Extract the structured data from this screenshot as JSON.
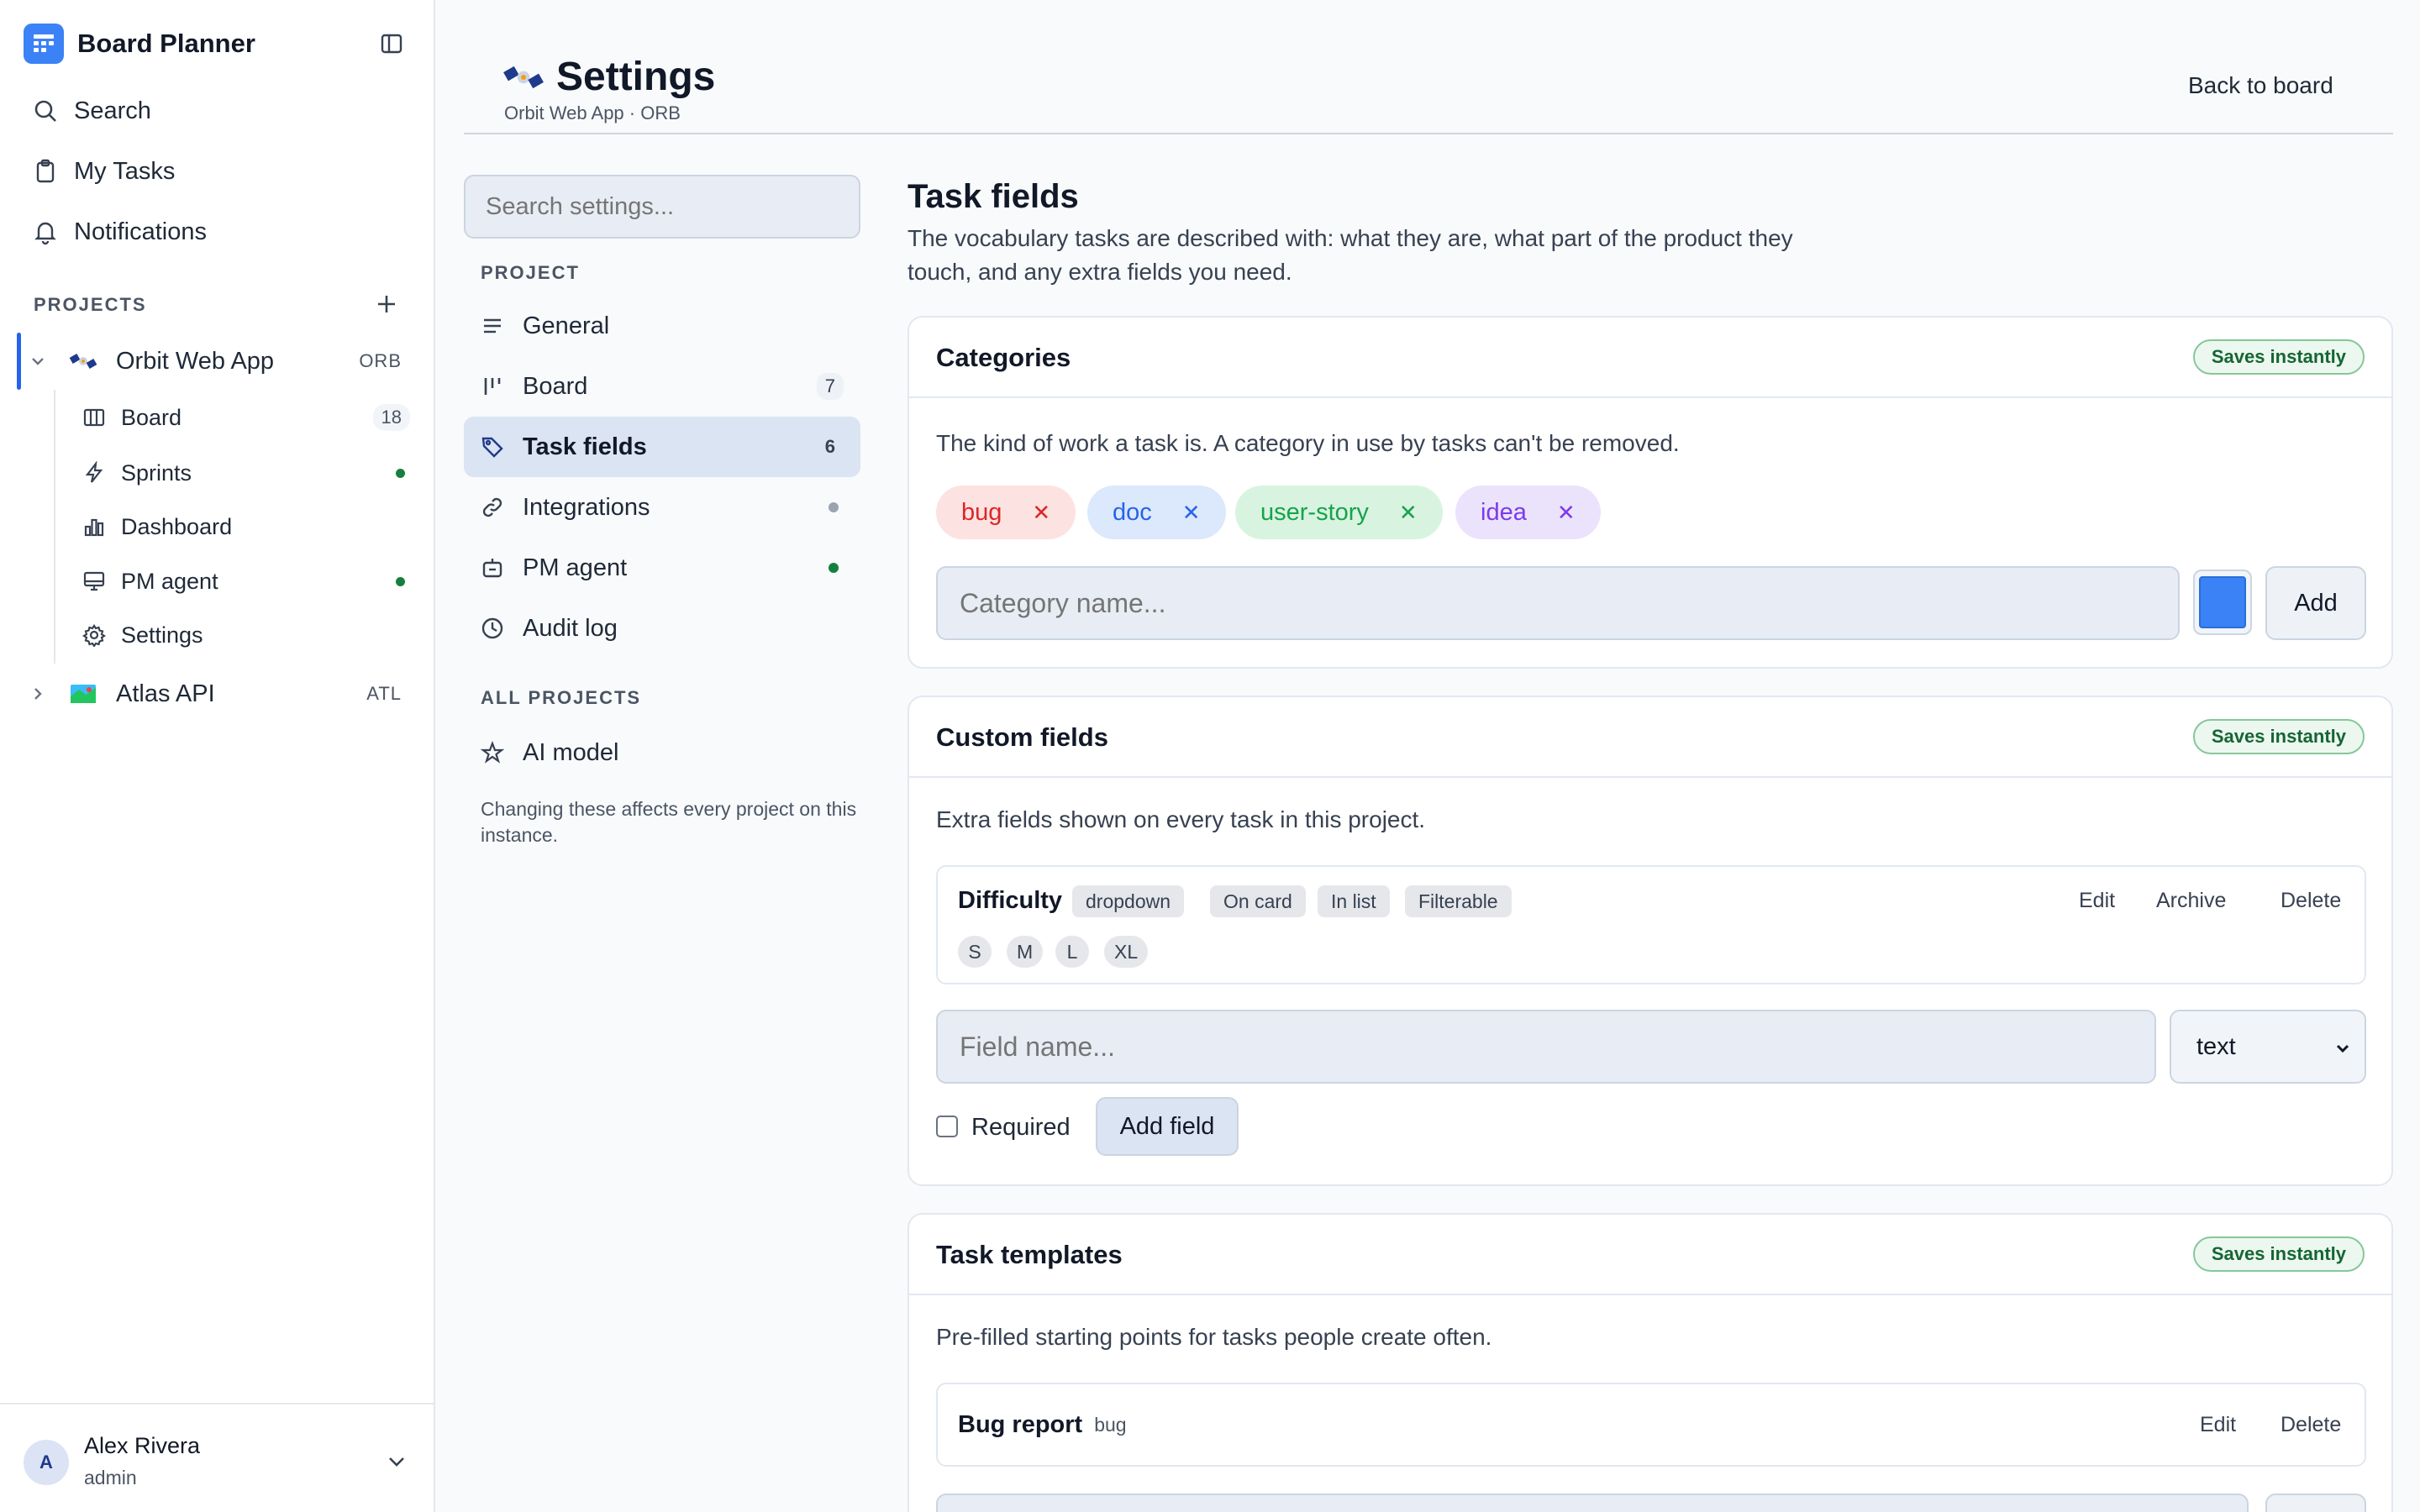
{
  "app": {
    "name": "Board Planner"
  },
  "nav": {
    "search": "Search",
    "my_tasks": "My Tasks",
    "notifications": "Notifications"
  },
  "projects": {
    "label": "PROJECTS",
    "items": [
      {
        "name": "Orbit Web App",
        "key": "ORB",
        "expanded": true,
        "children": [
          {
            "label": "Board",
            "count": "18",
            "icon": "columns-icon"
          },
          {
            "label": "Sprints",
            "status": "active",
            "icon": "lightning-icon"
          },
          {
            "label": "Dashboard",
            "icon": "bar-chart-icon"
          },
          {
            "label": "PM agent",
            "status": "active",
            "icon": "monitor-icon"
          },
          {
            "label": "Settings",
            "icon": "gear-icon"
          }
        ]
      },
      {
        "name": "Atlas API",
        "key": "ATL",
        "expanded": false
      }
    ]
  },
  "user": {
    "initial": "A",
    "name": "Alex Rivera",
    "role": "admin"
  },
  "header": {
    "title": "Settings",
    "subtitle": "Orbit Web App · ORB",
    "back_link": "Back to board"
  },
  "settings_nav": {
    "search_placeholder": "Search settings...",
    "project_label": "PROJECT",
    "items": [
      {
        "label": "General",
        "icon": "lines-icon"
      },
      {
        "label": "Board",
        "badge": "7",
        "icon": "board-icon"
      },
      {
        "label": "Task fields",
        "badge": "6",
        "icon": "tag-icon",
        "active": true
      },
      {
        "label": "Integrations",
        "status": "gray",
        "icon": "link-icon"
      },
      {
        "label": "PM agent",
        "status": "green",
        "icon": "bot-icon"
      },
      {
        "label": "Audit log",
        "icon": "clock-icon"
      }
    ],
    "all_projects_label": "ALL PROJECTS",
    "all_items": [
      {
        "label": "AI model",
        "icon": "star-icon"
      }
    ],
    "note": "Changing these affects every project on this instance."
  },
  "main": {
    "title": "Task fields",
    "description": "The vocabulary tasks are described with: what they are, what part of the product they touch, and any extra fields you need.",
    "categories": {
      "title": "Categories",
      "badge": "Saves instantly",
      "description": "The kind of work a task is. A category in use by tasks can't be removed.",
      "chips": [
        {
          "label": "bug",
          "color": "#fde2e2",
          "text_color": "#dc2626"
        },
        {
          "label": "doc",
          "color": "#dce8fb",
          "text_color": "#2563eb"
        },
        {
          "label": "user-story",
          "color": "#d9f3e1",
          "text_color": "#16a34a"
        },
        {
          "label": "idea",
          "color": "#ebe3fb",
          "text_color": "#7c3aed"
        }
      ],
      "input_placeholder": "Category name...",
      "swatch_color": "#3b82f6",
      "add_label": "Add"
    },
    "custom_fields": {
      "title": "Custom fields",
      "badge": "Saves instantly",
      "description": "Extra fields shown on every task in this project.",
      "fields": [
        {
          "name": "Difficulty",
          "tags": [
            "dropdown",
            "On card",
            "In list",
            "Filterable"
          ],
          "options": [
            "S",
            "M",
            "L",
            "XL"
          ],
          "actions": [
            "Edit",
            "Archive",
            "Delete"
          ]
        }
      ],
      "input_placeholder": "Field name...",
      "type_value": "text",
      "required_label": "Required",
      "add_field_label": "Add field"
    },
    "task_templates": {
      "title": "Task templates",
      "badge": "Saves instantly",
      "description": "Pre-filled starting points for tasks people create often.",
      "templates": [
        {
          "name": "Bug report",
          "category": "bug",
          "actions": [
            "Edit",
            "Delete"
          ]
        }
      ]
    }
  }
}
